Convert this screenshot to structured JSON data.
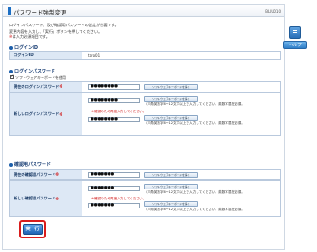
{
  "header": {
    "title": "パスワード強制変更",
    "screen_id": "BLIU010"
  },
  "help": {
    "label": "ヘルプ"
  },
  "intro": {
    "line1": "ログインパスワード、及び確認用パスワードの設定が必要です。",
    "line2": "変更内容を入力し、「実行」ボタンを押してください。",
    "required_mark": "※",
    "line3": "は入力必須項目です。"
  },
  "login_id": {
    "section_title": "ログインID",
    "label": "ログインID",
    "value": "taro01"
  },
  "login_password": {
    "section_title": "ログインパスワード",
    "keyboard_checkbox_label": "ソフトウェアキーボードを使用",
    "current_label": "現在のログインパスワード",
    "current_value": "●●●●●●●●",
    "new_label": "新しいログインパスワード",
    "new_value": "●●●●●●●●",
    "confirm_value": "●●●●●●●●",
    "keyboard_button": "ソフトウェアキーボードを開く",
    "hint": "（半角英数字6〜12文字以上で入力してください。英数字混在必須。）",
    "confirm_note": "※確認のため再度入力してください。"
  },
  "confirm_password": {
    "section_title": "確認用パスワード",
    "current_label": "現在の確認用パスワード",
    "current_value": "●●●●●●●",
    "new_label": "新しい確認用パスワード",
    "new_value": "●●●●●●●",
    "confirm_value": "●●●●●●●",
    "keyboard_button": "ソフトウェアキーボードを開く",
    "hint": "（半角英数字6〜12文字以上で入力してください。英数字混在必須。）",
    "confirm_note": "※確認のため再度入力してください。"
  },
  "required_mark": "※",
  "actions": {
    "run_label": "実　行"
  }
}
